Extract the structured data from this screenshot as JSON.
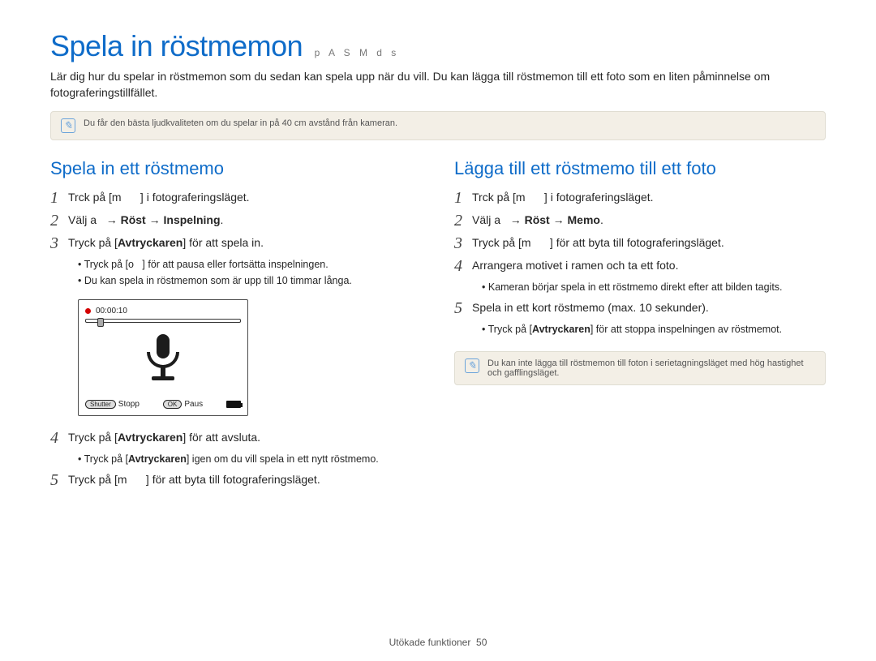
{
  "page": {
    "title": "Spela in röstmemon",
    "modes": "p A S M d s",
    "intro": "Lär dig hur du spelar in röstmemon som du sedan kan spela upp när du vill. Du kan lägga till röstmemon till ett foto som en liten påminnelse om fotograferingstillfället.",
    "top_tip": "Du får den bästa ljudkvaliteten om du spelar in på 40 cm avstånd från kameran."
  },
  "left": {
    "heading": "Spela in ett röstmemo",
    "steps": {
      "s1": "Trck på [m      ] i fotograferingsläget.",
      "s2_pre": "Välj a   ",
      "s2_arrow1": "→ ",
      "s2_b1": "Röst",
      "s2_arrow2": " → ",
      "s2_b2": "Inspelning",
      "s2_end": ".",
      "s3_pre": "Tryck på [",
      "s3_b": "Avtryckaren",
      "s3_post": "] för att spela in.",
      "s3_sub1_pre": "Tryck på [o   ] för att pausa eller fortsätta inspelningen.",
      "s3_sub2": "Du kan spela in röstmemon som är upp till 10 timmar långa.",
      "s4_pre": "Tryck på [",
      "s4_b": "Avtryckaren",
      "s4_post": "] för att avsluta.",
      "s4_sub_pre": "Tryck på [",
      "s4_sub_b": "Avtryckaren",
      "s4_sub_post": "] igen om du vill spela in ett nytt röstmemo.",
      "s5": "Tryck på [m      ] för att byta till fotograferingsläget."
    }
  },
  "screen": {
    "time": "00:00:10",
    "shutter": "Shutter",
    "stop": "Stopp",
    "ok": "OK",
    "paus": "Paus"
  },
  "right": {
    "heading": "Lägga till ett röstmemo till ett foto",
    "steps": {
      "s1": "Trck på [m      ] i fotograferingsläget.",
      "s2_pre": "Välj a   ",
      "s2_arrow1": "→ ",
      "s2_b1": "Röst",
      "s2_arrow2": " → ",
      "s2_b2": "Memo",
      "s2_end": ".",
      "s3": "Tryck på [m      ] för att byta till fotograferingsläget.",
      "s4": "Arrangera motivet i ramen och ta ett foto.",
      "s4_sub": "Kameran börjar spela in ett röstmemo direkt efter att bilden tagits.",
      "s5": "Spela in ett kort röstmemo (max. 10 sekunder).",
      "s5_sub_pre": "Tryck på [",
      "s5_sub_b": "Avtryckaren",
      "s5_sub_post": "] för att stoppa inspelningen av röstmemot."
    },
    "tip": "Du kan inte lägga till röstmemon till foton i serietagningsläget med hög hastighet och gafflingsläget."
  },
  "footer": {
    "section": "Utökade funktioner",
    "page_num": "50"
  }
}
